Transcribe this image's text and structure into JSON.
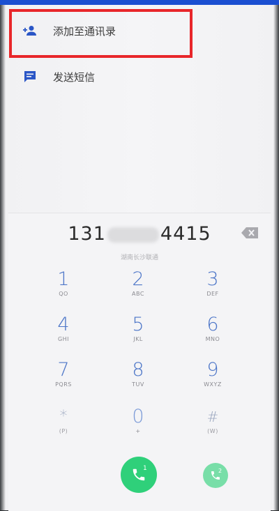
{
  "menu": {
    "items": [
      {
        "label": "添加至通讯录",
        "icon": "person-add-icon"
      },
      {
        "label": "发送短信",
        "icon": "message-icon"
      }
    ]
  },
  "dialer": {
    "number_prefix": "131",
    "number_suffix": "4415",
    "location": "湖南长沙联通",
    "keys": [
      {
        "digit": "1",
        "letters": "QO"
      },
      {
        "digit": "2",
        "letters": "ABC"
      },
      {
        "digit": "3",
        "letters": "DEF"
      },
      {
        "digit": "4",
        "letters": "GHI"
      },
      {
        "digit": "5",
        "letters": "JKL"
      },
      {
        "digit": "6",
        "letters": "MNO"
      },
      {
        "digit": "7",
        "letters": "PQRS"
      },
      {
        "digit": "8",
        "letters": "TUV"
      },
      {
        "digit": "9",
        "letters": "WXYZ"
      },
      {
        "digit": "*",
        "letters": "(P)"
      },
      {
        "digit": "0",
        "letters": "+"
      },
      {
        "digit": "#",
        "letters": "(W)"
      }
    ],
    "call_sim1_badge": "1",
    "call_sim2_badge": "2"
  },
  "colors": {
    "accent": "#2a56c6",
    "call_green": "#2fd07a",
    "highlight_red": "#e8262a"
  }
}
